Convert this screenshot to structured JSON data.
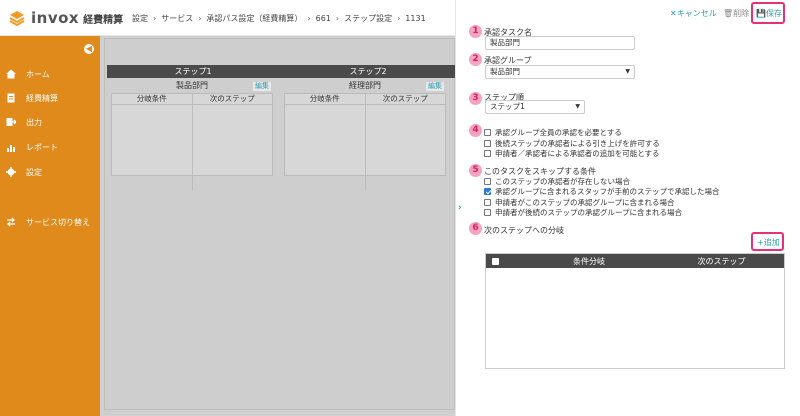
{
  "header": {
    "brand": "invox",
    "product": "経費精算",
    "breadcrumb": [
      "設定",
      "サービス",
      "承認パス設定（経費精算）",
      "661",
      "ステップ設定",
      "1131"
    ]
  },
  "sidebar": {
    "accent": "#e08a1c",
    "items": [
      {
        "label": "ホーム",
        "icon": "home-icon"
      },
      {
        "label": "経費精算",
        "icon": "document-icon"
      },
      {
        "label": "出力",
        "icon": "export-icon"
      },
      {
        "label": "レポート",
        "icon": "chart-icon"
      },
      {
        "label": "設定",
        "icon": "gear-icon"
      },
      {
        "label": "サービス切り替え",
        "icon": "switch-icon"
      }
    ]
  },
  "canvas": {
    "steps": [
      {
        "title": "ステップ1",
        "dept": "製品部門",
        "edit": "編集",
        "col1": "分岐条件",
        "col2": "次のステップ"
      },
      {
        "title": "ステップ2",
        "dept": "経理部門",
        "edit": "編集",
        "col1": "分岐条件",
        "col2": "次のステップ"
      }
    ]
  },
  "panel": {
    "actions": {
      "cancel": "キャンセル",
      "delete": "削除",
      "save": "保存"
    },
    "markers": [
      "1",
      "2",
      "3",
      "4",
      "5",
      "6"
    ],
    "task_name": {
      "label": "承認タスク名",
      "value": "製品部門"
    },
    "group": {
      "label": "承認グループ",
      "value": "製品部門"
    },
    "step_order": {
      "label": "ステップ順",
      "value": "ステップ1"
    },
    "options": [
      {
        "label": "承認グループ全員の承認を必要とする",
        "checked": false
      },
      {
        "label": "後続ステップの承認者による引き上げを許可する",
        "checked": false
      },
      {
        "label": "申請者／承認者による承認者の追加を可能とする",
        "checked": false
      }
    ],
    "skip": {
      "label": "このタスクをスキップする条件",
      "items": [
        {
          "label": "このステップの承認者が存在しない場合",
          "checked": false
        },
        {
          "label": "承認グループに含まれるスタッフが手前のステップで承認した場合",
          "checked": true
        },
        {
          "label": "申請者がこのステップの承認グループに含まれる場合",
          "checked": false
        },
        {
          "label": "申請者が後続のステップの承認グループに含まれる場合",
          "checked": false
        }
      ]
    },
    "branch": {
      "label": "次のステップへの分岐",
      "add": "追加",
      "columns": [
        "条件分岐",
        "次のステップ"
      ]
    },
    "highlight_color": "#e8307a",
    "link_color": "#2a9bb0"
  }
}
